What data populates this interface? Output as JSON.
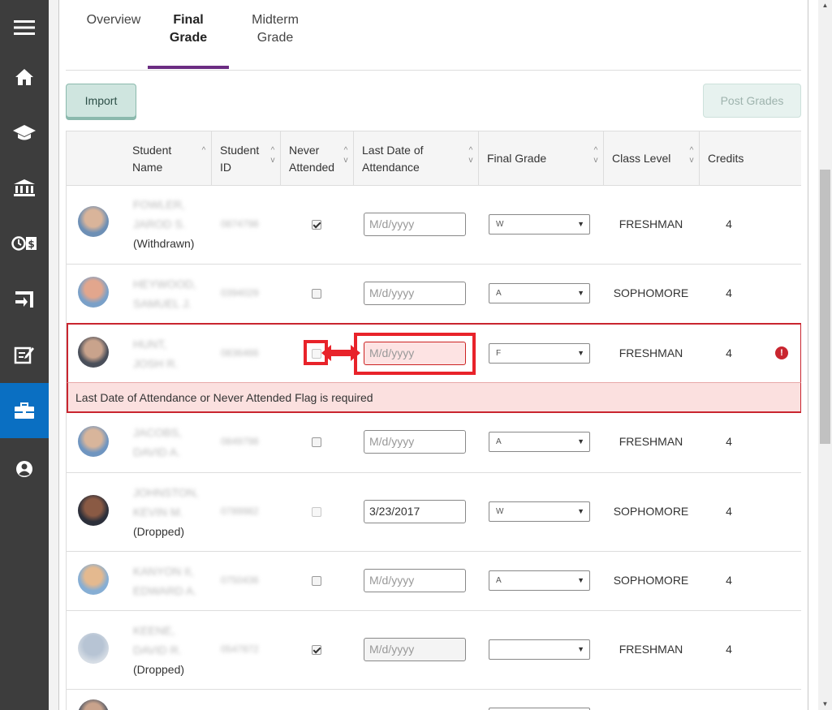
{
  "nav": {
    "items": [
      {
        "icon": "menu-icon"
      },
      {
        "icon": "home-icon"
      },
      {
        "icon": "graduation-cap-icon"
      },
      {
        "icon": "institution-icon"
      },
      {
        "icon": "clock-dollar-icon"
      },
      {
        "icon": "exit-sign-icon"
      },
      {
        "icon": "edit-note-icon"
      },
      {
        "icon": "briefcase-icon"
      },
      {
        "icon": "user-circle-icon"
      }
    ],
    "active_index": 7
  },
  "tabs": [
    {
      "label": "Overview"
    },
    {
      "label": "Final Grade"
    },
    {
      "label": "Midterm Grade"
    }
  ],
  "active_tab": "Final Grade",
  "toolbar": {
    "import_label": "Import",
    "post_grades_label": "Post Grades"
  },
  "table": {
    "columns": [
      {
        "label": "Student Name"
      },
      {
        "label": "Student ID"
      },
      {
        "label": "Never Attended"
      },
      {
        "label": "Last Date of Attendance"
      },
      {
        "label": "Final Grade"
      },
      {
        "label": "Class Level"
      },
      {
        "label": "Credits"
      }
    ],
    "rows": [
      {
        "name": "FOWLER, JAROD S.",
        "status": "(Withdrawn)",
        "student_id": "0874798",
        "never_attended": true,
        "date": "",
        "date_placeholder": "M/d/yyyy",
        "grade": "W",
        "class_level": "FRESHMAN",
        "credits": "4"
      },
      {
        "name": "HEYWOOD, SAMUEL J.",
        "status": "",
        "student_id": "0394029",
        "never_attended": false,
        "date": "",
        "date_placeholder": "M/d/yyyy",
        "grade": "A",
        "class_level": "SOPHOMORE",
        "credits": "4"
      },
      {
        "name": "HUNT, JOSH R.",
        "status": "",
        "student_id": "0836466",
        "never_attended": false,
        "date": "",
        "date_placeholder": "M/d/yyyy",
        "grade": "F",
        "class_level": "FRESHMAN",
        "credits": "4",
        "error": true
      },
      {
        "name": "JACOBS, DAVID A.",
        "status": "",
        "student_id": "0849798",
        "never_attended": false,
        "date": "",
        "date_placeholder": "M/d/yyyy",
        "grade": "A",
        "class_level": "FRESHMAN",
        "credits": "4"
      },
      {
        "name": "JOHNSTON, KEVIN M.",
        "status": "(Dropped)",
        "student_id": "0789982",
        "never_attended": false,
        "date": "3/23/2017",
        "date_placeholder": "M/d/yyyy",
        "grade": "W",
        "class_level": "SOPHOMORE",
        "credits": "4"
      },
      {
        "name": "KANYON II, EDWARD A.",
        "status": "",
        "student_id": "0750436",
        "never_attended": false,
        "date": "",
        "date_placeholder": "M/d/yyyy",
        "grade": "A",
        "class_level": "SOPHOMORE",
        "credits": "4"
      },
      {
        "name": "KEENE, DAVID R.",
        "status": "(Dropped)",
        "student_id": "0547872",
        "never_attended": true,
        "date": "",
        "date_placeholder": "M/d/yyyy",
        "grade": "",
        "class_level": "FRESHMAN",
        "credits": "4"
      }
    ],
    "error_message": "Last Date of Attendance or Never Attended Flag is required",
    "error_icon": "exclamation-circle-icon"
  },
  "colors": {
    "nav_bg": "#3d3d3d",
    "nav_active": "#0a6fc2",
    "tab_accent": "#6b2c82",
    "error": "#c9252f",
    "highlight": "#e8232a"
  }
}
